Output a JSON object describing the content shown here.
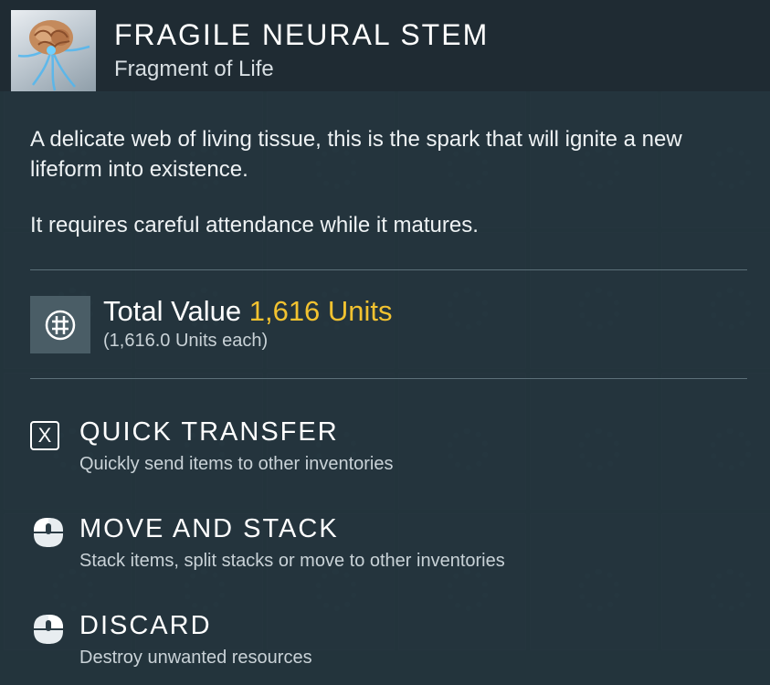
{
  "item": {
    "name": "FRAGILE NEURAL STEM",
    "category": "Fragment of Life",
    "icon": "neural-stem-icon"
  },
  "description": {
    "paragraph1": "A delicate web of living tissue, this is the spark that will ignite a new lifeform into existence.",
    "paragraph2": "It requires careful attendance while it matures."
  },
  "value": {
    "label": "Total Value",
    "amount": "1,616 Units",
    "each": "(1,616.0 Units each)",
    "icon": "units-currency-icon",
    "accent_color": "#f2c230"
  },
  "actions": [
    {
      "key": "X",
      "icon": "x-key-icon",
      "title": "QUICK TRANSFER",
      "subtitle": "Quickly send items to other inventories"
    },
    {
      "icon": "mouse-left-click-icon",
      "title": "MOVE AND STACK",
      "subtitle": "Stack items, split stacks or move to other inventories"
    },
    {
      "icon": "mouse-right-click-icon",
      "title": "DISCARD",
      "subtitle": "Destroy unwanted resources"
    }
  ]
}
